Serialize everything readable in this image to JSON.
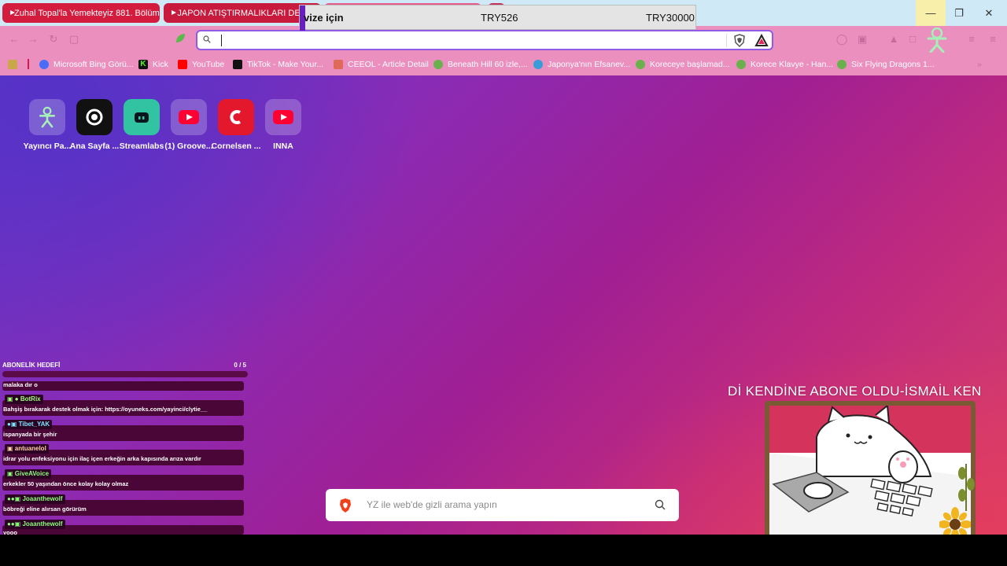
{
  "tabs": [
    {
      "title": "Zuhal Topal'la Yemekteyiz 881. Bölüm"
    },
    {
      "title": "JAPON ATIŞTIRMALIKLARI DENİY"
    }
  ],
  "overlay": {
    "title": "vize için",
    "price1": "TRY526",
    "price2": "TRY30000"
  },
  "omnibox": {
    "value": "",
    "placeholder": ""
  },
  "bookmarks": [
    {
      "label": "Microsoft Bing Görü...",
      "color": "#4a6cf7",
      "icon": "bing-icon"
    },
    {
      "label": "Kick",
      "color": "#53fc18",
      "icon": "kick-icon"
    },
    {
      "label": "YouTube",
      "color": "#ff0000",
      "icon": "youtube-icon"
    },
    {
      "label": "TikTok - Make Your...",
      "color": "#111111",
      "icon": "tiktok-icon"
    },
    {
      "label": "CEEOL - Article Detail",
      "color": "#d9534f",
      "icon": "ceeol-icon"
    },
    {
      "label": "Beneath Hill 60 izle,...",
      "color": "#6ab04c",
      "icon": "globe-icon"
    },
    {
      "label": "Japonya'nın Efsanev...",
      "color": "#3a9bd9",
      "icon": "site-icon"
    },
    {
      "label": "Koreceye başlamad...",
      "color": "#6ab04c",
      "icon": "globe-icon"
    },
    {
      "label": "Korece Klavye - Han...",
      "color": "#6ab04c",
      "icon": "globe-icon"
    },
    {
      "label": "Six Flying Dragons 1...",
      "color": "#6ab04c",
      "icon": "globe-icon"
    }
  ],
  "tiles": [
    {
      "label": "Yayıncı Pa...",
      "icon": "yayinci-icon"
    },
    {
      "label": "Ana Sayfa ...",
      "icon": "target-icon"
    },
    {
      "label": "Streamlabs",
      "icon": "streamlabs-icon"
    },
    {
      "label": "(1) Groove...",
      "icon": "youtube-icon"
    },
    {
      "label": "Cornelsen ...",
      "icon": "cornelsen-icon"
    },
    {
      "label": "INNA",
      "icon": "youtube-icon"
    }
  ],
  "search": {
    "placeholder": "YZ ile web'de gizli arama yapın"
  },
  "chat": {
    "goal_label": "ABONELİK HEDEFİ",
    "goal_count": "0  / 5",
    "messages": [
      {
        "user": "",
        "text": "malaka dır o",
        "color": "#ffffff"
      },
      {
        "user": "BotRix",
        "text": "Bahşiş bırakarak destek olmak için: https://oyuneks.com/yayinci/clytie__",
        "color": "#a0ff7a"
      },
      {
        "user": "Tibet_YAK",
        "text": "ispanyada bir şehir",
        "color": "#7ee8ff"
      },
      {
        "user": "antuanelol",
        "text": "idrar yolu enfeksiyonu için ilaç içen erkeğin arka kapısında arıza vardır",
        "color": "#ffd3a8"
      },
      {
        "user": "GiveAVoice",
        "text": "erkekler 50 yaşından önce kolay kolay olmaz",
        "color": "#8cff7a"
      },
      {
        "user": "Joaanthewolf",
        "text": "böbreği eline alırsan görürüm",
        "color": "#8cff7a"
      },
      {
        "user": "Joaanthewolf",
        "text": "yooo",
        "color": "#8cff7a"
      }
    ]
  },
  "ticker": {
    "text": "Dİ KENDİNE ABONE OLDU-İSMAİL KEN"
  }
}
